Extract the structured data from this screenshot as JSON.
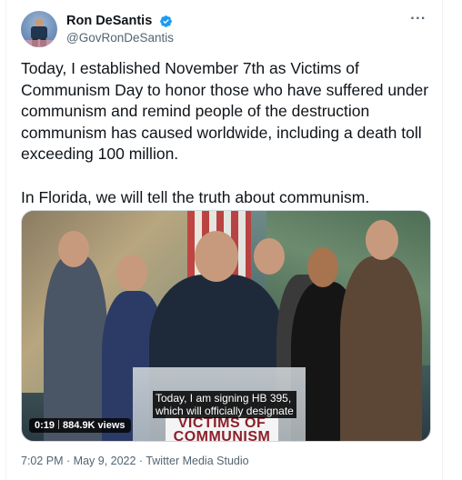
{
  "author": {
    "name": "Ron DeSantis",
    "handle": "@GovRonDeSantis",
    "verified_icon": "verified-badge-icon"
  },
  "tweet": {
    "text": "Today, I established November 7th as Victims of Communism Day to honor those who have suffered under communism and remind people of the destruction communism has caused worldwide, including a death toll exceeding 100 million.\n\nIn Florida, we will tell the truth about communism."
  },
  "video": {
    "duration": "0:19",
    "views": "884.9K views",
    "caption_line1": "Today, I am signing HB 395,",
    "caption_line2": "which will officially designate",
    "sign_line1": "VICTIMS OF",
    "sign_line2": "COMMUNISM"
  },
  "meta": {
    "timestamp": "7:02 PM · May 9, 2022 · Twitter Media Studio"
  },
  "colors": {
    "accent": "#1d9bf0",
    "text": "#0f1419",
    "secondary": "#536471"
  }
}
